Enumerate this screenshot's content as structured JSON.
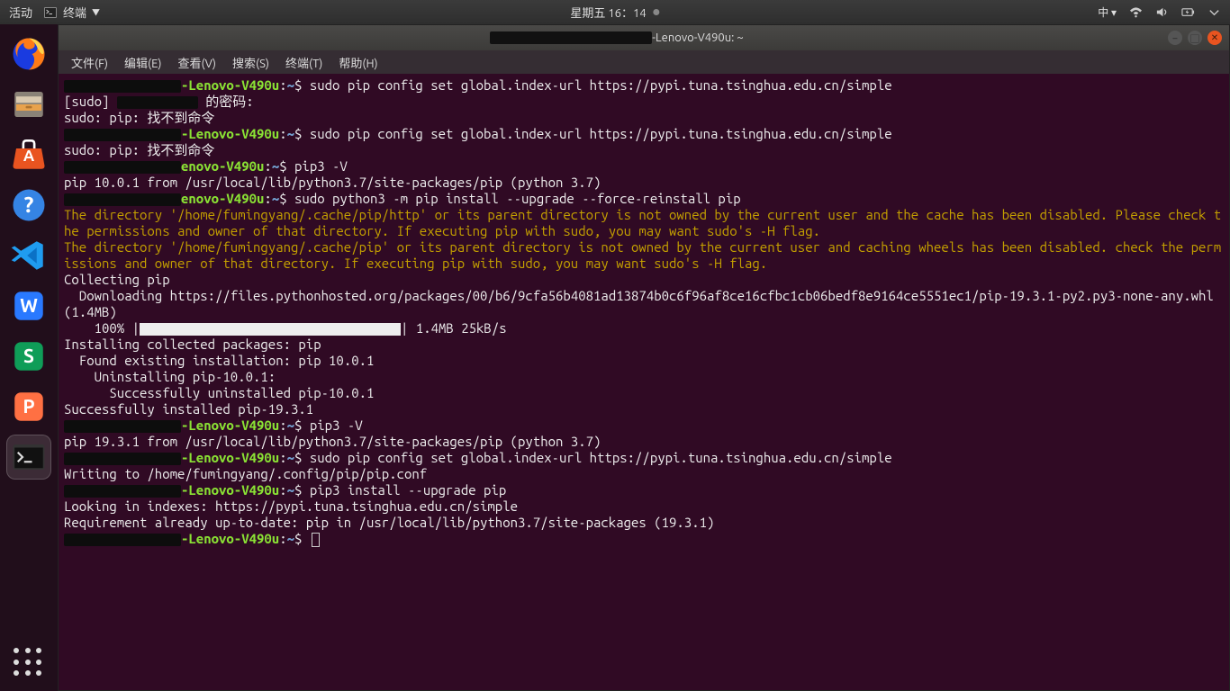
{
  "topbar": {
    "activities": "活动",
    "appmenu": "终端",
    "clock": "星期五 16：14",
    "ime": "中 ▾"
  },
  "dock": {
    "items": [
      "firefox",
      "files",
      "software",
      "help",
      "vscode",
      "wps-writer",
      "wps-spreadsheet",
      "wps-presentation",
      "terminal"
    ],
    "active": "terminal"
  },
  "window": {
    "title_suffix": "-Lenovo-V490u: ~"
  },
  "menubar": [
    "文件(F)",
    "编辑(E)",
    "查看(V)",
    "搜索(S)",
    "终端(T)",
    "帮助(H)"
  ],
  "prompt": {
    "host": "-Lenovo-V490u",
    "cwd": "~",
    "sep": ":",
    "sym": "$"
  },
  "lines": {
    "cmd1": " sudo pip config set global.index-url https://pypi.tuna.tsinghua.edu.cn/simple",
    "sudo_pw": "[sudo] ",
    "sudo_pw2": " 的密码:",
    "err_notfound": "sudo: pip: 找不到命令",
    "cmd2": " sudo pip config set global.index-url https://pypi.tuna.tsinghua.edu.cn/simple",
    "cmd3": " pip3 -V",
    "pipv1": "pip 10.0.1 from /usr/local/lib/python3.7/site-packages/pip (python 3.7)",
    "cmd4": " sudo python3 -m pip install --upgrade --force-reinstall pip",
    "warn1": "The directory '/home/fumingyang/.cache/pip/http' or its parent directory is not owned by the current user and the cache has been disabled. Please check the permissions and owner of that directory. If executing pip with sudo, you may want sudo's -H flag.",
    "warn2": "The directory '/home/fumingyang/.cache/pip' or its parent directory is not owned by the current user and caching wheels has been disabled. check the permissions and owner of that directory. If executing pip with sudo, you may want sudo's -H flag.",
    "collect": "Collecting pip",
    "dl": "  Downloading https://files.pythonhosted.org/packages/00/b6/9cfa56b4081ad13874b0c6f96af8ce16cfbc1cb06bedf8e9164ce5551ec1/pip-19.3.1-py2.py3-none-any.whl (1.4MB)",
    "progress_pct": "    100% |",
    "progress_rate": "| 1.4MB 25kB/s",
    "inst1": "Installing collected packages: pip",
    "inst2": "  Found existing installation: pip 10.0.1",
    "inst3": "    Uninstalling pip-10.0.1:",
    "inst4": "      Successfully uninstalled pip-10.0.1",
    "inst5": "Successfully installed pip-19.3.1",
    "cmd5": " pip3 -V",
    "pipv2": "pip 19.3.1 from /usr/local/lib/python3.7/site-packages/pip (python 3.7)",
    "cmd6": " sudo pip config set global.index-url https://pypi.tuna.tsinghua.edu.cn/simple",
    "writing": "Writing to /home/fumingyang/.config/pip/pip.conf",
    "cmd7": " pip3 install --upgrade pip",
    "look": "Looking in indexes: https://pypi.tuna.tsinghua.edu.cn/simple",
    "req": "Requirement already up-to-date: pip in /usr/local/lib/python3.7/site-packages (19.3.1)"
  }
}
